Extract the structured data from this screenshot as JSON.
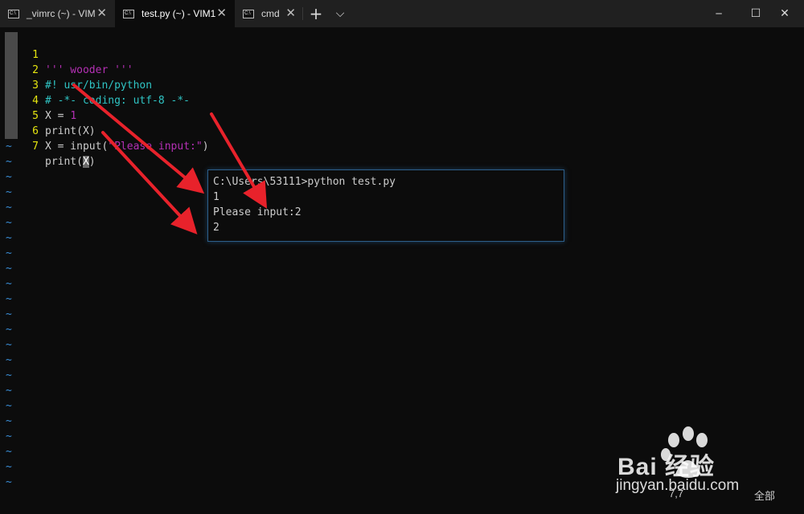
{
  "tabs": [
    {
      "title": "_vimrc (~) - VIM",
      "icon": "console-icon",
      "active": false
    },
    {
      "title": "test.py (~) - VIM1",
      "icon": "console-icon",
      "active": true
    },
    {
      "title": "cmd",
      "icon": "console-icon",
      "active": false
    }
  ],
  "tab_controls": {
    "new_tab": "+",
    "dropdown": "⌵"
  },
  "window_controls": {
    "minimize": "─",
    "maximize": "☐",
    "close": "✕"
  },
  "editor": {
    "line_numbers": [
      "1",
      "2",
      "3",
      "4",
      "5",
      "6",
      "7"
    ],
    "lines": [
      {
        "a": "''' wooder '''"
      },
      {
        "a": "#! usr/bin/python"
      },
      {
        "a": "# -*- coding: utf-8 -*-"
      },
      {
        "a": "X = ",
        "b": "1"
      },
      {
        "a": "print(X)"
      },
      {
        "a": "X = input(",
        "b": "\"Please input:\"",
        "c": ")"
      },
      {
        "a": "print(",
        "b": "X",
        "c": ")"
      }
    ],
    "tilde": "~"
  },
  "console_output": {
    "lines": [
      "C:\\Users\\53111>python test.py",
      "1",
      "Please input:2",
      "2"
    ]
  },
  "status": {
    "position": "7,7",
    "scroll": "全部"
  },
  "watermark": {
    "brand": "Bai  经验",
    "url": "jingyan.baidu.com"
  },
  "colors": {
    "background": "#0c0c0c",
    "line_number": "#e5e510",
    "string": "#b530b5",
    "comment": "#2fc4c4",
    "tilde": "#3a8fd8",
    "arrow": "#e8222b"
  }
}
